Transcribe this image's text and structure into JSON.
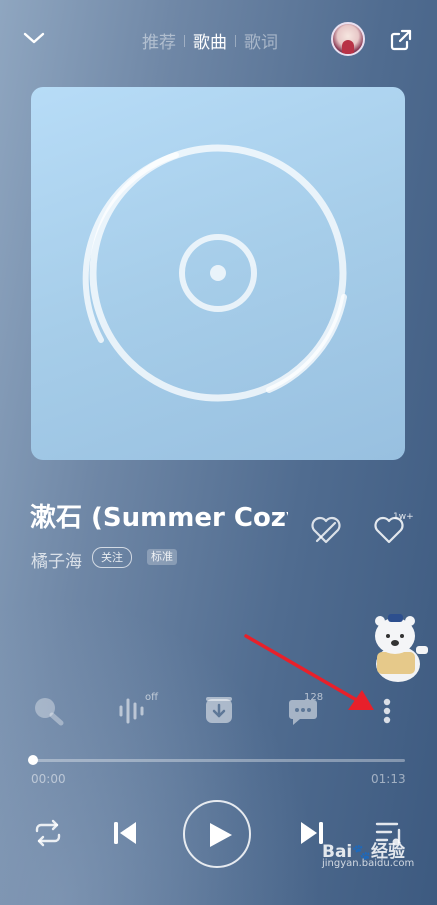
{
  "header": {
    "tabs": [
      {
        "label": "推荐",
        "active": false
      },
      {
        "label": "歌曲",
        "active": true
      },
      {
        "label": "歌词",
        "active": false
      }
    ],
    "icons": {
      "collapse": "chevron-down-icon",
      "share": "share-icon"
    }
  },
  "song": {
    "title": "漱石 (Summer Cozy",
    "artist": "橘子海",
    "follow_label": "关注",
    "quality_label": "标准",
    "like_count": "1w+"
  },
  "toolbar": {
    "sound_effect_badge": "off",
    "comment_count": "128",
    "icons": [
      "search-icon",
      "sound-effect-icon",
      "download-icon",
      "comment-icon",
      "more-icon"
    ]
  },
  "progress": {
    "current_time": "00:00",
    "total_time": "01:13",
    "fraction": 0.0
  },
  "controls": {
    "icons": [
      "repeat-icon",
      "previous-icon",
      "play-icon",
      "next-icon",
      "playlist-icon"
    ]
  },
  "watermark": {
    "logo_text": "Bai",
    "logo_suffix": "经验",
    "url": "jingyan.baidu.com"
  },
  "colors": {
    "background_start": "#8fa6c0",
    "background_end": "#3d5a80",
    "cover": "#a6cde9",
    "annotation_arrow": "#e8202a"
  }
}
